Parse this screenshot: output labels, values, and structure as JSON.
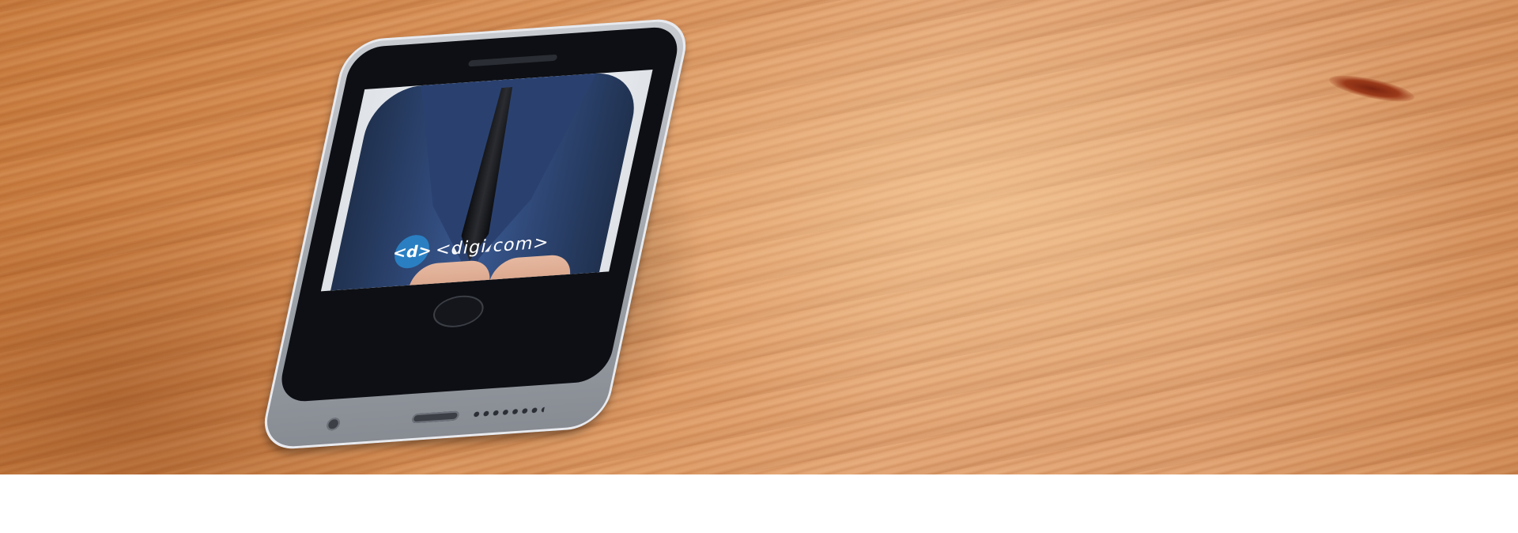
{
  "scene": {
    "surface": "wooden-table",
    "wood_color": "#d8925a"
  },
  "phone": {
    "screen": {
      "logo_badge": "<d>",
      "logo_text": "<digi com>",
      "logo_color": "#2a7fc2",
      "suit_color": "#2f4877"
    }
  }
}
